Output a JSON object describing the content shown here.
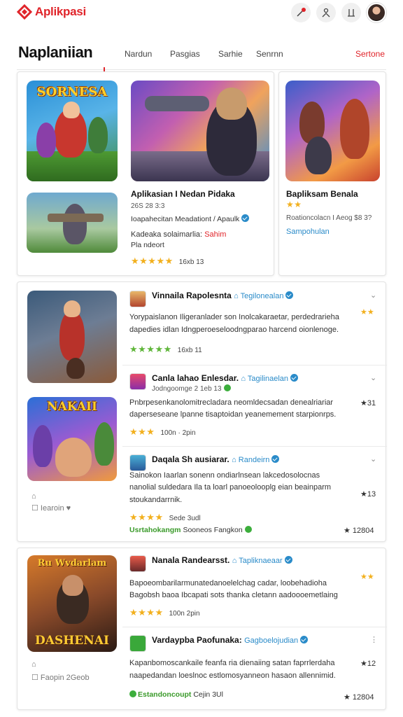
{
  "header": {
    "logo_text": "Aplikpasi",
    "icons": [
      "edit-icon",
      "user-icon",
      "sort-icon",
      "profile-avatar"
    ]
  },
  "nav": {
    "title": "Naplaniian",
    "tabs": [
      "Nardun",
      "Pasgias",
      "Sarhie",
      "Senrnn"
    ],
    "right_link": "Sertone"
  },
  "featured": {
    "big_art_1": "SORNESA",
    "main_title": "Aplikasian I Nedan Pidaka",
    "main_meta": "26S 28 3:3",
    "main_desc": "Ioapahecitan Meadationt / Apaulk",
    "main_tag_label": "Kadeaka solaimarlia:",
    "main_tag_value": "Sahim",
    "main_extra": "Pla ndeort",
    "main_rating": "★★★★★",
    "main_count": "16xb 13",
    "side_title": "Bapliksam Benala",
    "side_rating": "★★",
    "side_desc": "Roationcolacn I Aeog $8 3?",
    "side_link": "Sampohulan"
  },
  "group1": {
    "items": [
      {
        "title": "Vinnaila Rapolesnta",
        "badge": "Tegilonealan",
        "line1": "Yorypaislanon Iligeranlader son Inolcakaraetar, perdedrarieha",
        "line2": "dapedies idlan Idngperoeseloodngparao harcend oionlenoge.",
        "rating": "★★★★★",
        "count": "16xb 11",
        "score": "★★"
      },
      {
        "title": "Canla lahao Enlesdar.",
        "badge": "Tagilinaelan",
        "meta": "Jodngoomge 2 1eb 13",
        "line1": "Pnbrpesenkanolomitrecladara neomldecsadan denealriariar",
        "line2": "daperseseane lpanne tisaptoidan yeanemement starpionrps.",
        "rating": "★★★",
        "count": "100n · 2pin",
        "score": "★31"
      },
      {
        "title": "Daqala Sh ausiarar.",
        "badge": "Randeirn",
        "line1": "Sainokon Iaarlan sonenn ondiarlnsean lakcedosolocnas",
        "line2": "nanolial suldedara Ila ta loarl panoeolooplg eian beainparm",
        "line3": "stoukandarrnik.",
        "rating": "★★★★",
        "count": "Sede 3udl",
        "footer_green": "Usrtahokangm",
        "footer_text": "Sooneos Fangkon",
        "score": "★13",
        "score_total": "★ 12804"
      }
    ],
    "side_label": "Iearoin",
    "art_banner": "NAKAII"
  },
  "group2": {
    "art_banner_top": "Ru Wvdarlam",
    "art_banner_bottom": "DASHENAI",
    "items": [
      {
        "title": "Nanala Randearsst.",
        "badge": "Tapliknaeaar",
        "line1": "Bapoeombarilarmunatedanoelelchag cadar, loobehadioha",
        "line2": "Bagobsh baoa Ibcapati sots thanka cletann aadoooemetlaing",
        "rating": "★★★★",
        "count": "100n 2pin",
        "score": "★★"
      },
      {
        "title": "Vardaypba Paofunaka:",
        "badge": "Gagboelojudian",
        "line1": "Kapanbomoscankaile feanfa ria dienaiing satan faprrlerdaha",
        "line2": "naapedandan loeslnoc estlomosyanneon hasaon allennimid.",
        "footer_green": "Estandoncoupt",
        "footer_text": "Cejin 3Ul",
        "score": "★12",
        "score_total": "★ 12804"
      }
    ],
    "side_label_1": "Faopin",
    "side_label_2": "2Geob"
  },
  "colors": {
    "accent": "#e0242a",
    "star": "#f2b01e",
    "link": "#2a8bc9",
    "positive": "#3cae3c"
  }
}
